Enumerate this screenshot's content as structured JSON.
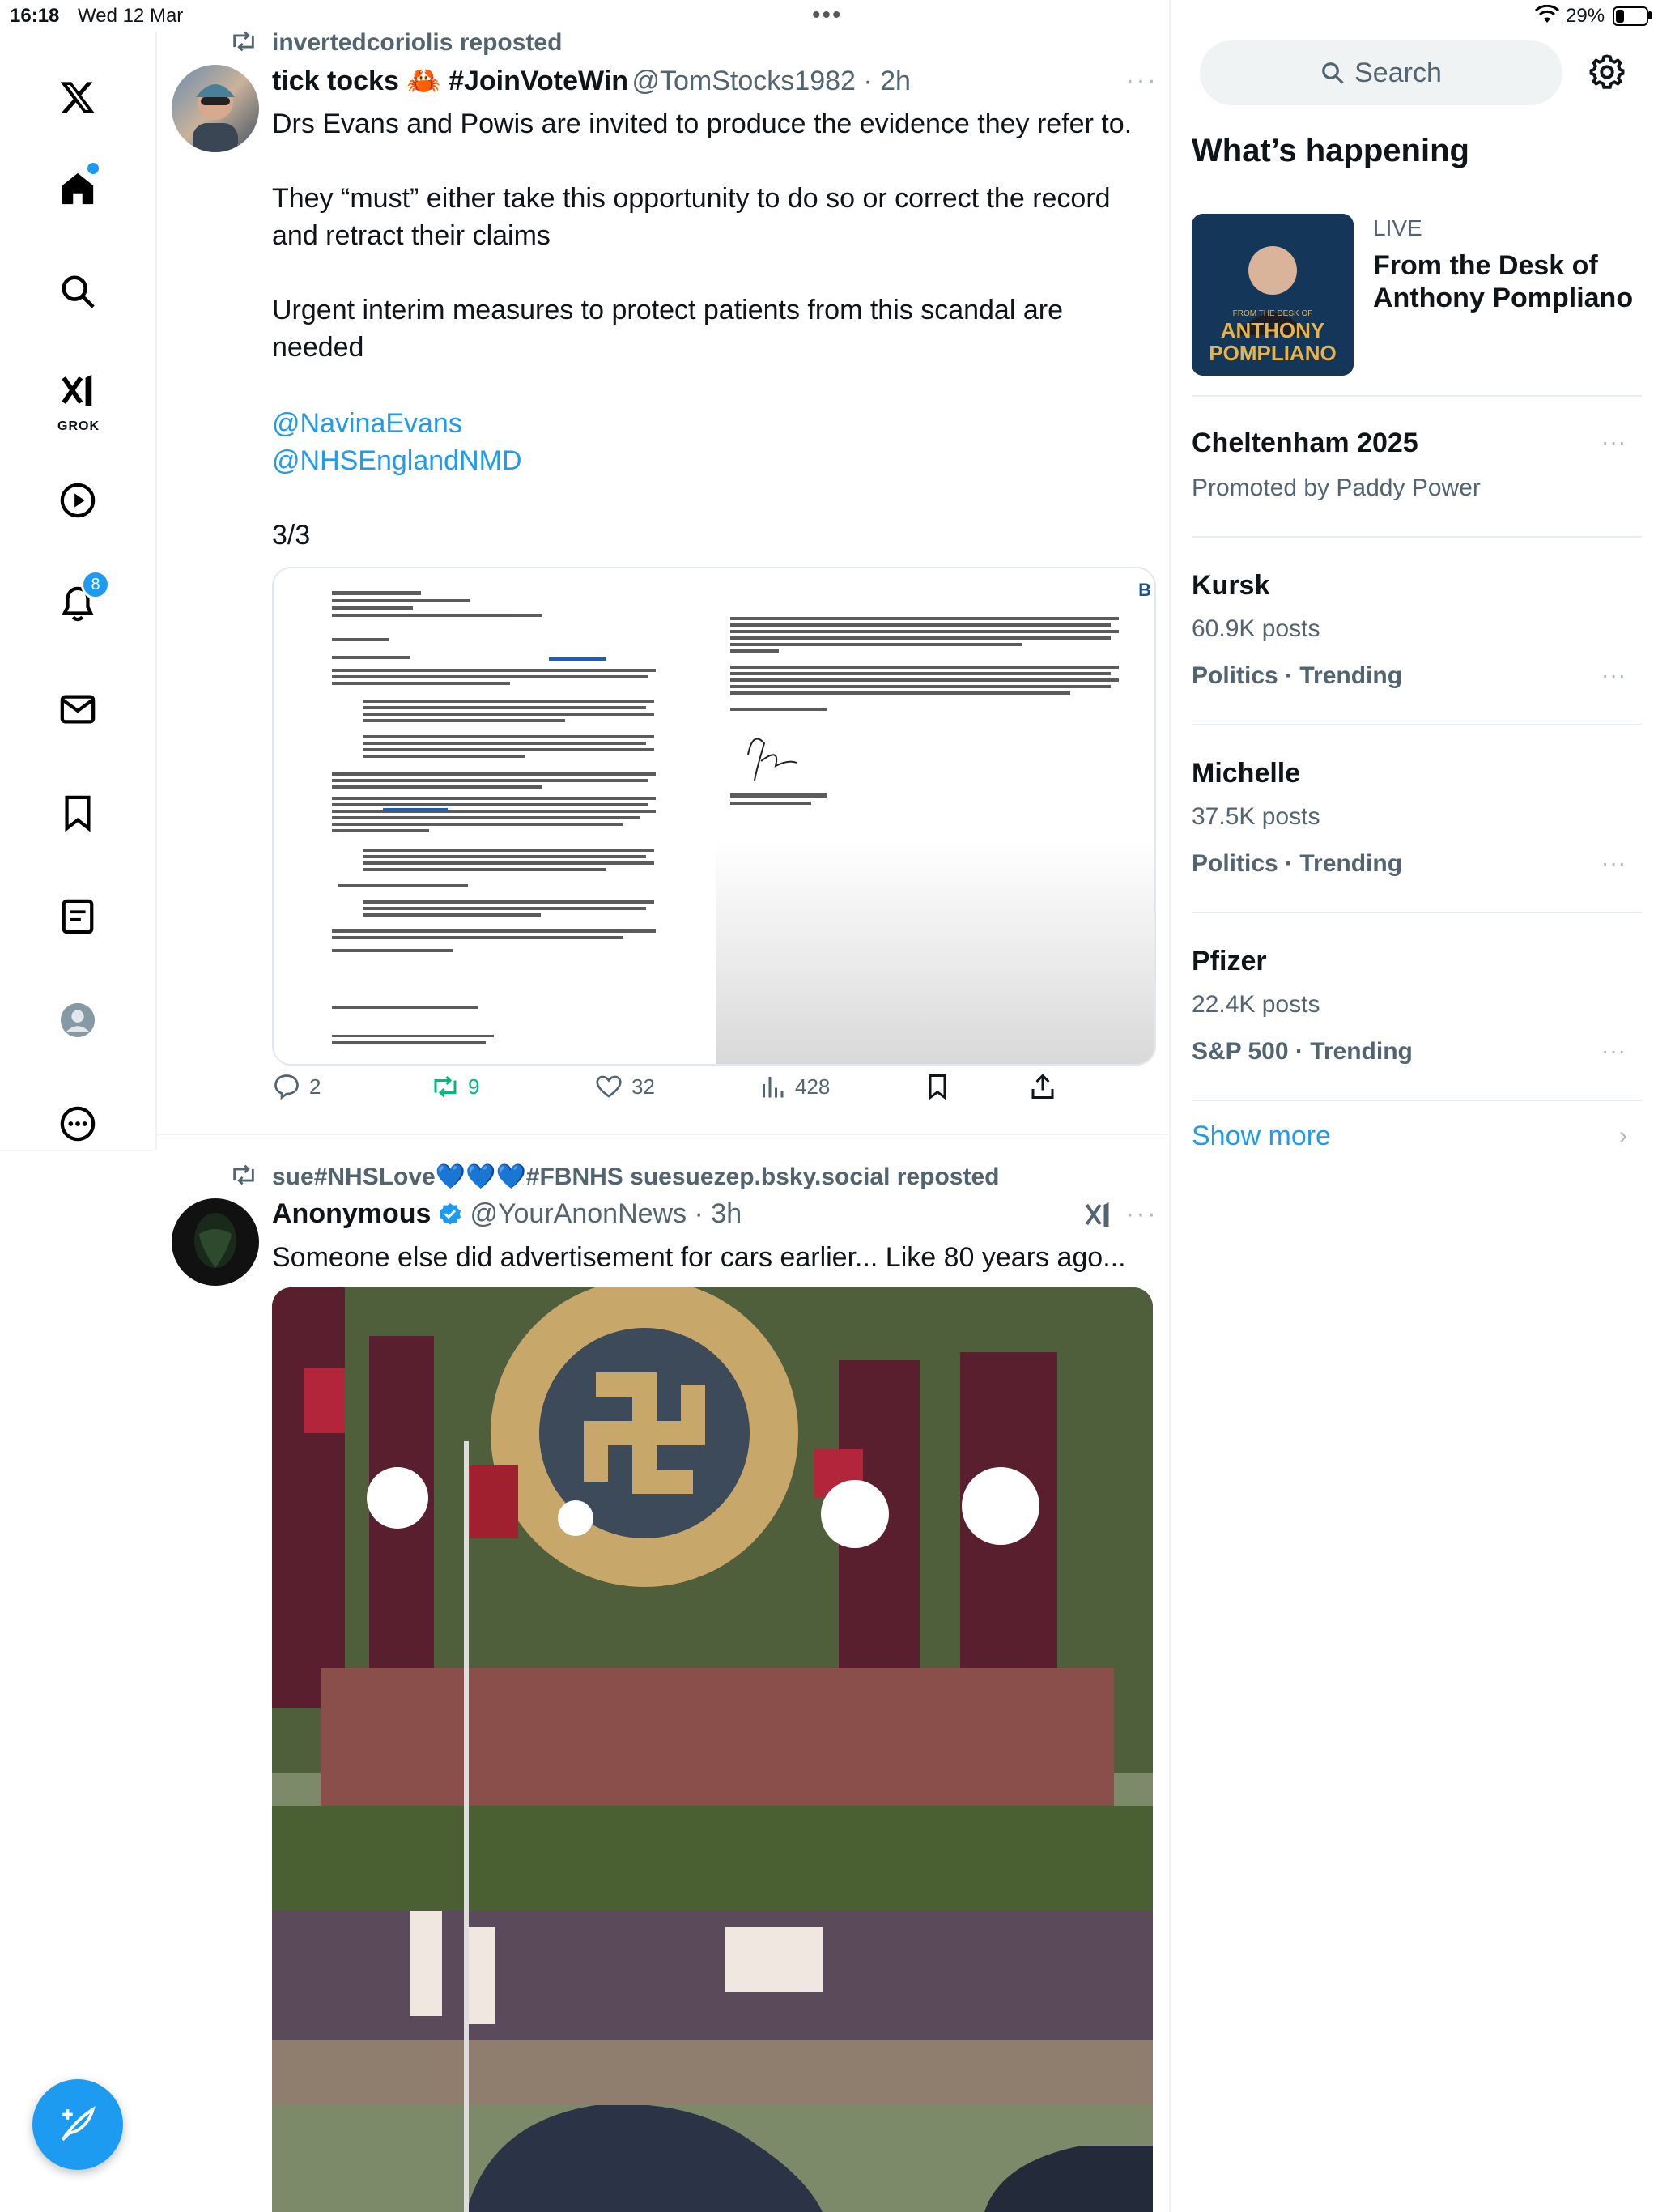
{
  "status_bar": {
    "time": "16:18",
    "date": "Wed 12 Mar",
    "battery": "29%"
  },
  "nav": {
    "notifications_badge": "8",
    "grok_label": "GROK"
  },
  "tweets": [
    {
      "repost_by": "invertedcoriolis reposted",
      "name": "tick tocks 🦀 #JoinVoteWin",
      "handle": "@TomStocks1982 · 2h",
      "text_1": "Drs Evans and Powis are invited to produce the evidence they refer to.",
      "text_2": "They “must” either take this opportunity to do so or correct the record\nand retract their claims",
      "text_3": "Urgent interim measures to protect patients from this scandal are\nneeded",
      "mention_1": "@NavinaEvans",
      "mention_2": "@NHSEnglandNMD",
      "page": "3/3",
      "replies": "2",
      "reposts": "9",
      "likes": "32",
      "views": "428"
    },
    {
      "repost_by": "sue#NHSLove💙💙💙#FBNHS suesuezep.bsky.social reposted",
      "name": "Anonymous",
      "handle": "@YourAnonNews · 3h",
      "text": "Someone else did advertisement for cars earlier... Like 80 years ago..."
    }
  ],
  "sidebar": {
    "search_placeholder": "Search",
    "whats_happening": "What’s happening",
    "live_label": "LIVE",
    "live_title": "From the Desk of Anthony Pompliano",
    "live_thumb_small": "FROM THE DESK OF",
    "live_thumb_name_1": "ANTHONY",
    "live_thumb_name_2": "POMPLIANO",
    "promoted_title": "Cheltenham 2025",
    "promoted_by": "Promoted by Paddy Power",
    "trends": [
      {
        "title": "Kursk",
        "posts": "60.9K posts",
        "category": "Politics · Trending"
      },
      {
        "title": "Michelle",
        "posts": "37.5K posts",
        "category": "Politics · Trending"
      },
      {
        "title": "Pfizer",
        "posts": "22.4K posts",
        "category": "S&P 500 · Trending"
      }
    ],
    "show_more": "Show more"
  }
}
